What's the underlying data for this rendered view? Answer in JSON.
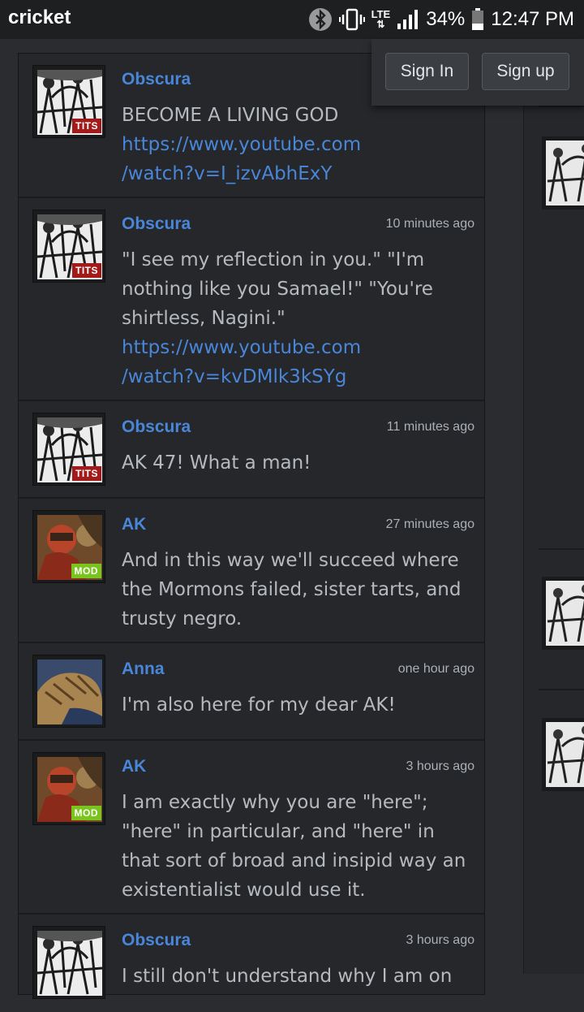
{
  "status_bar": {
    "carrier": "cricket",
    "network": "LTE",
    "battery": "34%",
    "time": "12:47 PM"
  },
  "auth": {
    "sign_in": "Sign In",
    "sign_up": "Sign up"
  },
  "comments": [
    {
      "author": "Obscura",
      "time": "",
      "badge": "TITS",
      "text": "BECOME A LIVING GOD",
      "link1": "https://www.youtube.com",
      "link2": "/watch?v=I_izvAbhExY"
    },
    {
      "author": "Obscura",
      "time": "10 minutes ago",
      "badge": "TITS",
      "text": "\"I see my reflection in you.\" \"I'm nothing like you Samael!\" \"You're shirtless, Nagini.\"",
      "link1": "https://www.youtube.com",
      "link2": "/watch?v=kvDMlk3kSYg"
    },
    {
      "author": "Obscura",
      "time": "11 minutes ago",
      "badge": "TITS",
      "text": "AK 47! What a man!"
    },
    {
      "author": "AK",
      "time": "27 minutes ago",
      "badge": "MOD",
      "text": "And in this way we'll succeed where the Mormons failed, sister tarts, and trusty negro."
    },
    {
      "author": "Anna",
      "time": "one hour ago",
      "text": "I'm also here for my dear AK!"
    },
    {
      "author": "AK",
      "time": "3 hours ago",
      "badge": "MOD",
      "text": "I am exactly why you are \"here\"; \"here\" in particular, and \"here\" in that sort of broad and insipid way an existentialist would use it."
    },
    {
      "author": "Obscura",
      "time": "3 hours ago",
      "text": "I still don't understand why I am on"
    }
  ]
}
